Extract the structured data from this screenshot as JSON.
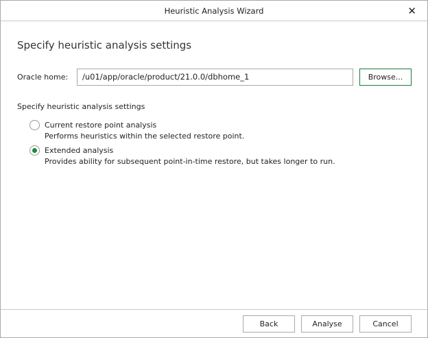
{
  "window": {
    "title": "Heuristic Analysis Wizard",
    "close_icon": "close-icon"
  },
  "main": {
    "heading": "Specify heuristic analysis settings",
    "oracle_home_label": "Oracle home:",
    "oracle_home_value": "/u01/app/oracle/product/21.0.0/dbhome_1",
    "browse_label": "Browse...",
    "section_label": "Specify heuristic analysis settings",
    "options": [
      {
        "label": "Current restore point analysis",
        "description": "Performs heuristics within the selected restore point.",
        "selected": false
      },
      {
        "label": "Extended analysis",
        "description": "Provides ability for subsequent point-in-time restore, but takes longer to run.",
        "selected": true
      }
    ]
  },
  "footer": {
    "back": "Back",
    "analyse": "Analyse",
    "cancel": "Cancel"
  },
  "colors": {
    "accent": "#1a8a3e"
  }
}
